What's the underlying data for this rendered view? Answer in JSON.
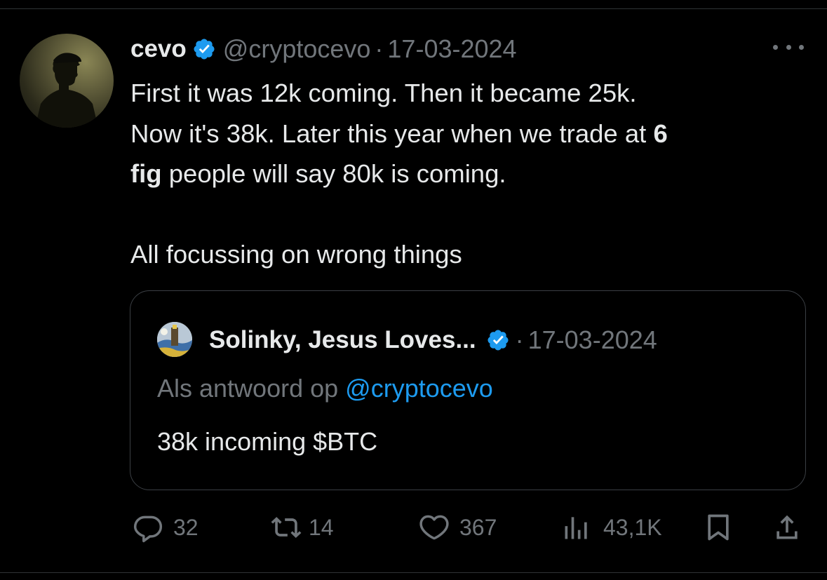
{
  "tweet": {
    "display_name": "cevo",
    "handle": "@cryptocevo",
    "separator": "·",
    "date": "17-03-2024",
    "avatar_icon": "avatar-silhouette",
    "verified_color": "#1d9bf0",
    "text_line1": "First it was 12k coming. Then it became 25k.",
    "text_line2_a": "Now it's 38k. Later this year when we trade at ",
    "text_line2_bold": "6",
    "text_line3_bold": "fig",
    "text_line3_b": " people will say 80k is coming.",
    "text_line4": "All focussing on wrong things"
  },
  "quote": {
    "display_name": "Solinky, Jesus Loves...",
    "separator": "·",
    "date": "17-03-2024",
    "reply_prefix": "Als antwoord op ",
    "reply_mention": "@cryptocevo",
    "text": "38k incoming $BTC",
    "mention_color": "#1d9bf0"
  },
  "actions": {
    "replies": "32",
    "reposts": "14",
    "likes": "367",
    "views": "43,1K"
  },
  "colors": {
    "background": "#000000",
    "primary_text": "#e7e9ea",
    "secondary_text": "#71767b",
    "accent": "#1d9bf0",
    "border": "#3b3f44"
  }
}
